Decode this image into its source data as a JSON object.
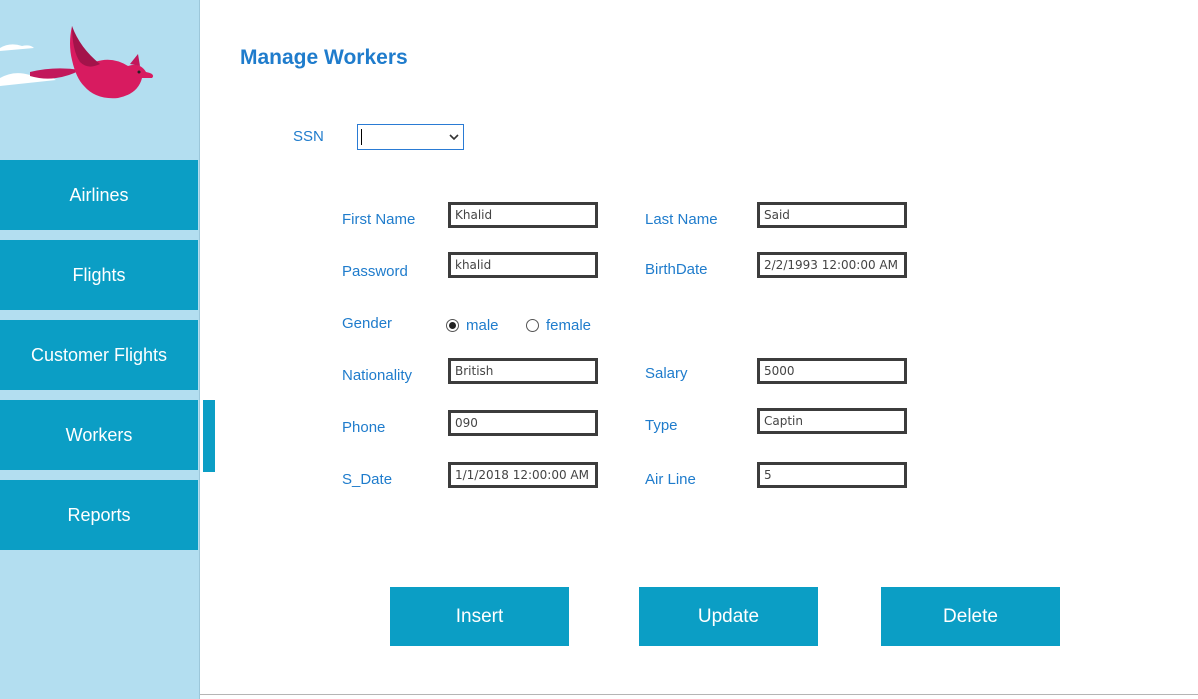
{
  "page": {
    "title": "Manage Workers"
  },
  "colors": {
    "accent": "#0b9ec5",
    "label": "#1f7ccc",
    "sidebar_bg": "#b3def0"
  },
  "sidebar": {
    "logo_icon": "bird-logo-icon",
    "items": [
      {
        "label": "Airlines"
      },
      {
        "label": "Flights"
      },
      {
        "label": "Customer Flights"
      },
      {
        "label": "Workers",
        "active": true
      },
      {
        "label": "Reports"
      }
    ]
  },
  "form": {
    "ssn": {
      "label": "SSN",
      "value": ""
    },
    "first_name": {
      "label": "First Name",
      "value": "Khalid"
    },
    "last_name": {
      "label": "Last Name",
      "value": "Said"
    },
    "password": {
      "label": "Password",
      "value": "khalid"
    },
    "birthdate": {
      "label": "BirthDate",
      "value": "2/2/1993 12:00:00 AM"
    },
    "gender": {
      "label": "Gender",
      "options": [
        "male",
        "female"
      ],
      "selected": "male"
    },
    "nationality": {
      "label": "Nationality",
      "value": "British"
    },
    "salary": {
      "label": "Salary",
      "value": "5000"
    },
    "phone": {
      "label": "Phone",
      "value": "090"
    },
    "type": {
      "label": "Type",
      "value": "Captin"
    },
    "s_date": {
      "label": "S_Date",
      "value": "1/1/2018 12:00:00 AM"
    },
    "airline": {
      "label": "Air Line",
      "value": "5"
    }
  },
  "buttons": {
    "insert": "Insert",
    "update": "Update",
    "delete": "Delete"
  }
}
